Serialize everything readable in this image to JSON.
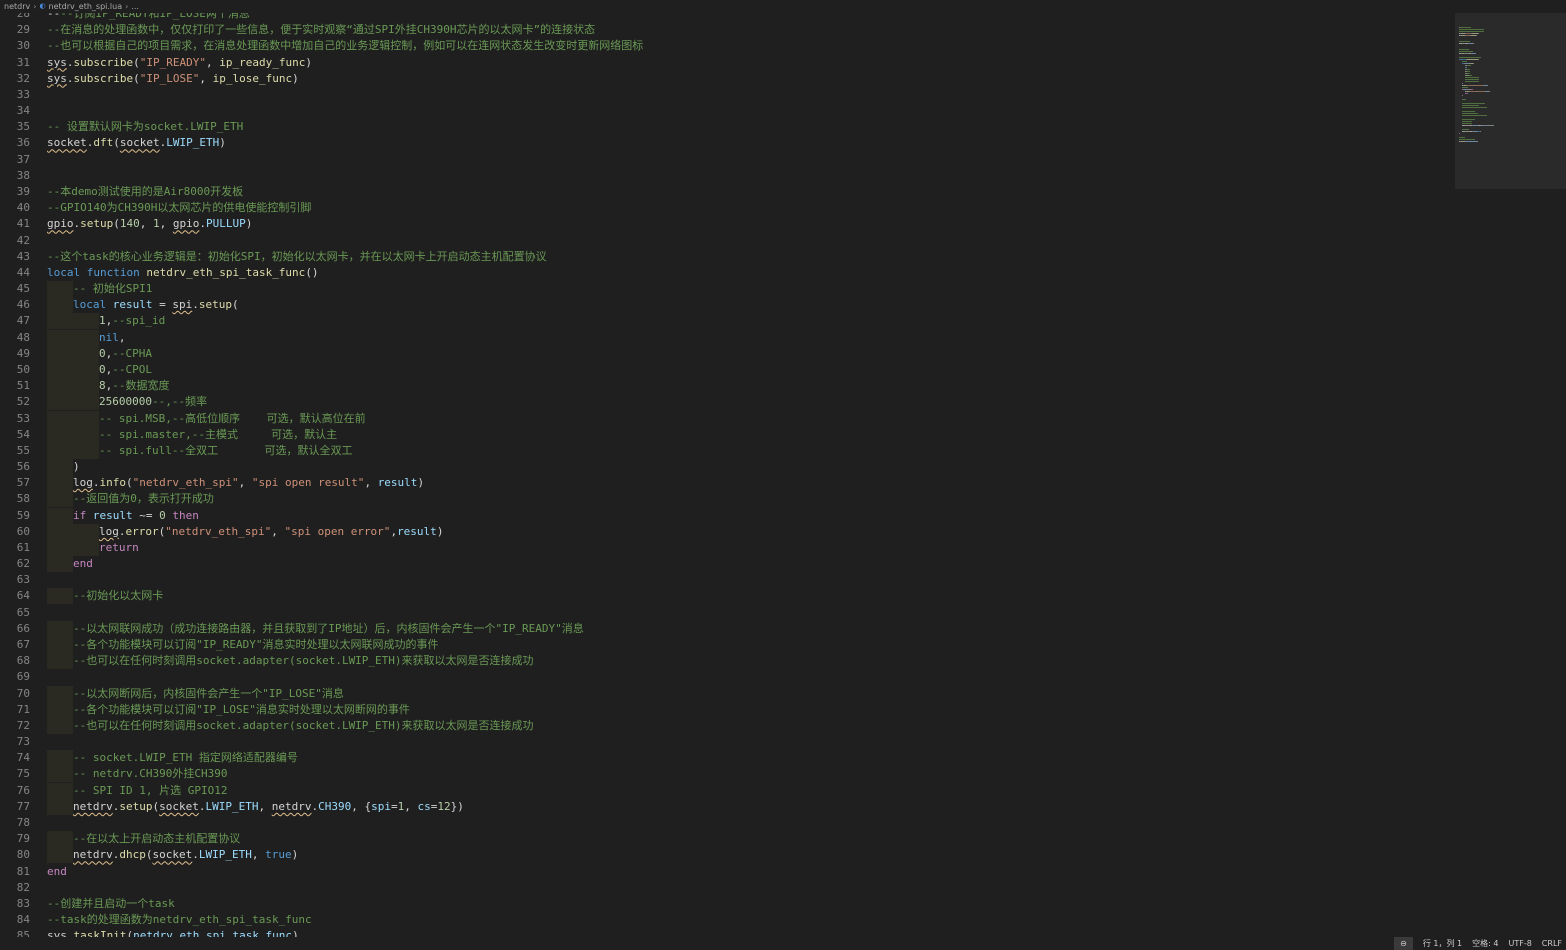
{
  "breadcrumb": {
    "folder": "netdrv",
    "file": "netdrv_eth_spi.lua",
    "symbol": "..."
  },
  "status_bar": {
    "zoom": "⊖",
    "position": "行 1，列 1",
    "spaces": "空格: 4",
    "encoding": "UTF-8",
    "eol": "CRLF"
  },
  "colors": {
    "comment": "#6a9955",
    "string": "#ce9178",
    "keyword": "#569cd6",
    "function": "#dcdcaa",
    "variable": "#9cdcfe",
    "number": "#b5cea8"
  },
  "lines": [
    {
      "n": "28",
      "indent": 0,
      "tokens": [
        [
          "--",
          ""
        ],
        [
          "--订阅IP_READY和IP_LOSE两个消息",
          "c"
        ]
      ]
    },
    {
      "n": "29",
      "indent": 0,
      "tokens": [
        [
          "--在消息的处理函数中，仅仅打印了一些信息，便于实时观察“通过SPI外挂CH390H芯片的以太网卡”的连接状态",
          "c"
        ]
      ]
    },
    {
      "n": "30",
      "indent": 0,
      "tokens": [
        [
          "--也可以根据自己的项目需求，在消息处理函数中增加自己的业务逻辑控制，例如可以在连网状态发生改变时更新网络图标",
          "c"
        ]
      ]
    },
    {
      "n": "31",
      "indent": 0,
      "tokens": [
        [
          "sys",
          "w"
        ],
        [
          ".",
          ""
        ],
        [
          "subscribe",
          "f"
        ],
        [
          "(",
          ""
        ],
        [
          "\"IP_READY\"",
          "s"
        ],
        [
          ", ",
          ""
        ],
        [
          "ip_ready_func",
          "f"
        ],
        [
          ")",
          ""
        ]
      ]
    },
    {
      "n": "32",
      "indent": 0,
      "tokens": [
        [
          "sys",
          "w"
        ],
        [
          ".",
          ""
        ],
        [
          "subscribe",
          "f"
        ],
        [
          "(",
          ""
        ],
        [
          "\"IP_LOSE\"",
          "s"
        ],
        [
          ", ",
          ""
        ],
        [
          "ip_lose_func",
          "f"
        ],
        [
          ")",
          ""
        ]
      ]
    },
    {
      "n": "33",
      "indent": 0,
      "tokens": []
    },
    {
      "n": "34",
      "indent": 0,
      "tokens": []
    },
    {
      "n": "35",
      "indent": 0,
      "tokens": [
        [
          "-- 设置默认网卡为socket.LWIP_ETH",
          "c"
        ]
      ]
    },
    {
      "n": "36",
      "indent": 0,
      "tokens": [
        [
          "socket",
          "w"
        ],
        [
          ".",
          ""
        ],
        [
          "dft",
          "f"
        ],
        [
          "(",
          ""
        ],
        [
          "socket",
          "w"
        ],
        [
          ".",
          ""
        ],
        [
          "LWIP_ETH",
          "v"
        ],
        [
          ")",
          ""
        ]
      ]
    },
    {
      "n": "37",
      "indent": 0,
      "tokens": []
    },
    {
      "n": "38",
      "indent": 0,
      "tokens": []
    },
    {
      "n": "39",
      "indent": 0,
      "tokens": [
        [
          "--本demo测试使用的是Air8000开发板",
          "c"
        ]
      ]
    },
    {
      "n": "40",
      "indent": 0,
      "tokens": [
        [
          "--GPIO140为CH390H以太网芯片的供电使能控制引脚",
          "c"
        ]
      ]
    },
    {
      "n": "41",
      "indent": 0,
      "tokens": [
        [
          "gpio",
          "w"
        ],
        [
          ".",
          ""
        ],
        [
          "setup",
          "f"
        ],
        [
          "(",
          ""
        ],
        [
          "140",
          "n"
        ],
        [
          ", ",
          ""
        ],
        [
          "1",
          "n"
        ],
        [
          ", ",
          ""
        ],
        [
          "gpio",
          "w"
        ],
        [
          ".",
          ""
        ],
        [
          "PULLUP",
          "v"
        ],
        [
          ")",
          ""
        ]
      ]
    },
    {
      "n": "42",
      "indent": 0,
      "tokens": []
    },
    {
      "n": "43",
      "indent": 0,
      "tokens": [
        [
          "--这个task的核心业务逻辑是：初始化SPI，初始化以太网卡，并在以太网卡上开启动态主机配置协议",
          "c"
        ]
      ]
    },
    {
      "n": "44",
      "indent": 0,
      "tokens": [
        [
          "local",
          "k"
        ],
        [
          " ",
          ""
        ],
        [
          "function",
          "k"
        ],
        [
          " ",
          ""
        ],
        [
          "netdrv_eth_spi_task_func",
          "f"
        ],
        [
          "()",
          ""
        ]
      ]
    },
    {
      "n": "45",
      "indent": 1,
      "tokens": [
        [
          "-- 初始化SPI1",
          "c"
        ]
      ]
    },
    {
      "n": "46",
      "indent": 1,
      "tokens": [
        [
          "local",
          "k"
        ],
        [
          " ",
          ""
        ],
        [
          "result",
          "v"
        ],
        [
          " = ",
          ""
        ],
        [
          "spi",
          "w"
        ],
        [
          ".",
          ""
        ],
        [
          "setup",
          "f"
        ],
        [
          "(",
          ""
        ]
      ]
    },
    {
      "n": "47",
      "indent": 2,
      "tokens": [
        [
          "1",
          "n"
        ],
        [
          ",",
          ""
        ],
        [
          "--spi_id",
          "c"
        ]
      ]
    },
    {
      "n": "48",
      "indent": 2,
      "tokens": [
        [
          "nil",
          "k"
        ],
        [
          ",",
          ""
        ]
      ]
    },
    {
      "n": "49",
      "indent": 2,
      "tokens": [
        [
          "0",
          "n"
        ],
        [
          ",",
          ""
        ],
        [
          "--CPHA",
          "c"
        ]
      ]
    },
    {
      "n": "50",
      "indent": 2,
      "tokens": [
        [
          "0",
          "n"
        ],
        [
          ",",
          ""
        ],
        [
          "--CPOL",
          "c"
        ]
      ]
    },
    {
      "n": "51",
      "indent": 2,
      "tokens": [
        [
          "8",
          "n"
        ],
        [
          ",",
          ""
        ],
        [
          "--数据宽度",
          "c"
        ]
      ]
    },
    {
      "n": "52",
      "indent": 2,
      "tokens": [
        [
          "25600000",
          "n"
        ],
        [
          "--,--频率",
          "c"
        ]
      ]
    },
    {
      "n": "53",
      "indent": 2,
      "tokens": [
        [
          "-- spi.MSB,--高低位顺序    可选，默认高位在前",
          "c"
        ]
      ]
    },
    {
      "n": "54",
      "indent": 2,
      "tokens": [
        [
          "-- spi.master,--主模式     可选，默认主",
          "c"
        ]
      ]
    },
    {
      "n": "55",
      "indent": 2,
      "tokens": [
        [
          "-- spi.full--全双工       可选，默认全双工",
          "c"
        ]
      ]
    },
    {
      "n": "56",
      "indent": 1,
      "tokens": [
        [
          ")",
          ""
        ]
      ]
    },
    {
      "n": "57",
      "indent": 1,
      "tokens": [
        [
          "log",
          "w"
        ],
        [
          ".",
          ""
        ],
        [
          "info",
          "f"
        ],
        [
          "(",
          ""
        ],
        [
          "\"netdrv_eth_spi\"",
          "s"
        ],
        [
          ", ",
          ""
        ],
        [
          "\"spi open result\"",
          "s"
        ],
        [
          ", ",
          ""
        ],
        [
          "result",
          "v"
        ],
        [
          ")",
          ""
        ]
      ]
    },
    {
      "n": "58",
      "indent": 1,
      "tokens": [
        [
          "--返回值为0，表示打开成功",
          "c"
        ]
      ]
    },
    {
      "n": "59",
      "indent": 1,
      "tokens": [
        [
          "if",
          "kc"
        ],
        [
          " ",
          ""
        ],
        [
          "result",
          "v"
        ],
        [
          " ~= ",
          ""
        ],
        [
          "0",
          "n"
        ],
        [
          " ",
          ""
        ],
        [
          "then",
          "kc"
        ]
      ]
    },
    {
      "n": "60",
      "indent": 2,
      "tokens": [
        [
          "log",
          "w"
        ],
        [
          ".",
          ""
        ],
        [
          "error",
          "f"
        ],
        [
          "(",
          ""
        ],
        [
          "\"netdrv_eth_spi\"",
          "s"
        ],
        [
          ", ",
          ""
        ],
        [
          "\"spi open error\"",
          "s"
        ],
        [
          ",",
          ""
        ],
        [
          "result",
          "v"
        ],
        [
          ")",
          ""
        ]
      ]
    },
    {
      "n": "61",
      "indent": 2,
      "tokens": [
        [
          "return",
          "kc"
        ]
      ]
    },
    {
      "n": "62",
      "indent": 1,
      "tokens": [
        [
          "end",
          "kc"
        ]
      ]
    },
    {
      "n": "63",
      "indent": 0,
      "tokens": []
    },
    {
      "n": "64",
      "indent": 1,
      "tokens": [
        [
          "--初始化以太网卡",
          "c"
        ]
      ]
    },
    {
      "n": "65",
      "indent": 0,
      "tokens": []
    },
    {
      "n": "66",
      "indent": 1,
      "tokens": [
        [
          "--以太网联网成功（成功连接路由器，并且获取到了IP地址）后，内核固件会产生一个\"IP_READY\"消息",
          "c"
        ]
      ]
    },
    {
      "n": "67",
      "indent": 1,
      "tokens": [
        [
          "--各个功能模块可以订阅\"IP_READY\"消息实时处理以太网联网成功的事件",
          "c"
        ]
      ]
    },
    {
      "n": "68",
      "indent": 1,
      "tokens": [
        [
          "--也可以在任何时刻调用socket.adapter(socket.LWIP_ETH)来获取以太网是否连接成功",
          "c"
        ]
      ]
    },
    {
      "n": "69",
      "indent": 0,
      "tokens": []
    },
    {
      "n": "70",
      "indent": 1,
      "tokens": [
        [
          "--以太网断网后，内核固件会产生一个\"IP_LOSE\"消息",
          "c"
        ]
      ]
    },
    {
      "n": "71",
      "indent": 1,
      "tokens": [
        [
          "--各个功能模块可以订阅\"IP_LOSE\"消息实时处理以太网断网的事件",
          "c"
        ]
      ]
    },
    {
      "n": "72",
      "indent": 1,
      "tokens": [
        [
          "--也可以在任何时刻调用socket.adapter(socket.LWIP_ETH)来获取以太网是否连接成功",
          "c"
        ]
      ]
    },
    {
      "n": "73",
      "indent": 0,
      "tokens": []
    },
    {
      "n": "74",
      "indent": 1,
      "tokens": [
        [
          "-- socket.LWIP_ETH 指定网络适配器编号",
          "c"
        ]
      ]
    },
    {
      "n": "75",
      "indent": 1,
      "tokens": [
        [
          "-- netdrv.CH390外挂CH390",
          "c"
        ]
      ]
    },
    {
      "n": "76",
      "indent": 1,
      "tokens": [
        [
          "-- SPI ID 1, 片选 GPIO12",
          "c"
        ]
      ]
    },
    {
      "n": "77",
      "indent": 1,
      "tokens": [
        [
          "netdrv",
          "w"
        ],
        [
          ".",
          ""
        ],
        [
          "setup",
          "f"
        ],
        [
          "(",
          ""
        ],
        [
          "socket",
          "w"
        ],
        [
          ".",
          ""
        ],
        [
          "LWIP_ETH",
          "v"
        ],
        [
          ", ",
          ""
        ],
        [
          "netdrv",
          "w"
        ],
        [
          ".",
          ""
        ],
        [
          "CH390",
          "v"
        ],
        [
          ", ",
          ""
        ],
        [
          "{",
          ""
        ],
        [
          "spi",
          "v"
        ],
        [
          "=",
          ""
        ],
        [
          "1",
          "n"
        ],
        [
          ", ",
          ""
        ],
        [
          "cs",
          "v"
        ],
        [
          "=",
          ""
        ],
        [
          "12",
          "n"
        ],
        [
          "})",
          ""
        ]
      ]
    },
    {
      "n": "78",
      "indent": 0,
      "tokens": []
    },
    {
      "n": "79",
      "indent": 1,
      "tokens": [
        [
          "--在以太上开启动态主机配置协议",
          "c"
        ]
      ]
    },
    {
      "n": "80",
      "indent": 1,
      "tokens": [
        [
          "netdrv",
          "w"
        ],
        [
          ".",
          ""
        ],
        [
          "dhcp",
          "f"
        ],
        [
          "(",
          ""
        ],
        [
          "socket",
          "w"
        ],
        [
          ".",
          ""
        ],
        [
          "LWIP_ETH",
          "v"
        ],
        [
          ", ",
          ""
        ],
        [
          "true",
          "k"
        ],
        [
          ")",
          ""
        ]
      ]
    },
    {
      "n": "81",
      "indent": 0,
      "tokens": [
        [
          "end",
          "kc"
        ]
      ]
    },
    {
      "n": "82",
      "indent": 0,
      "tokens": []
    },
    {
      "n": "83",
      "indent": 0,
      "tokens": [
        [
          "--创建并且启动一个task",
          "c"
        ]
      ]
    },
    {
      "n": "84",
      "indent": 0,
      "tokens": [
        [
          "--task的处理函数为netdrv_eth_spi_task_func",
          "c"
        ]
      ]
    },
    {
      "n": "85",
      "indent": 0,
      "tokens": [
        [
          "sys",
          "w"
        ],
        [
          ".",
          ""
        ],
        [
          "taskInit",
          "f"
        ],
        [
          "(",
          ""
        ],
        [
          "netdrv_eth_spi_task_func",
          "v"
        ],
        [
          ")",
          ""
        ]
      ]
    }
  ]
}
